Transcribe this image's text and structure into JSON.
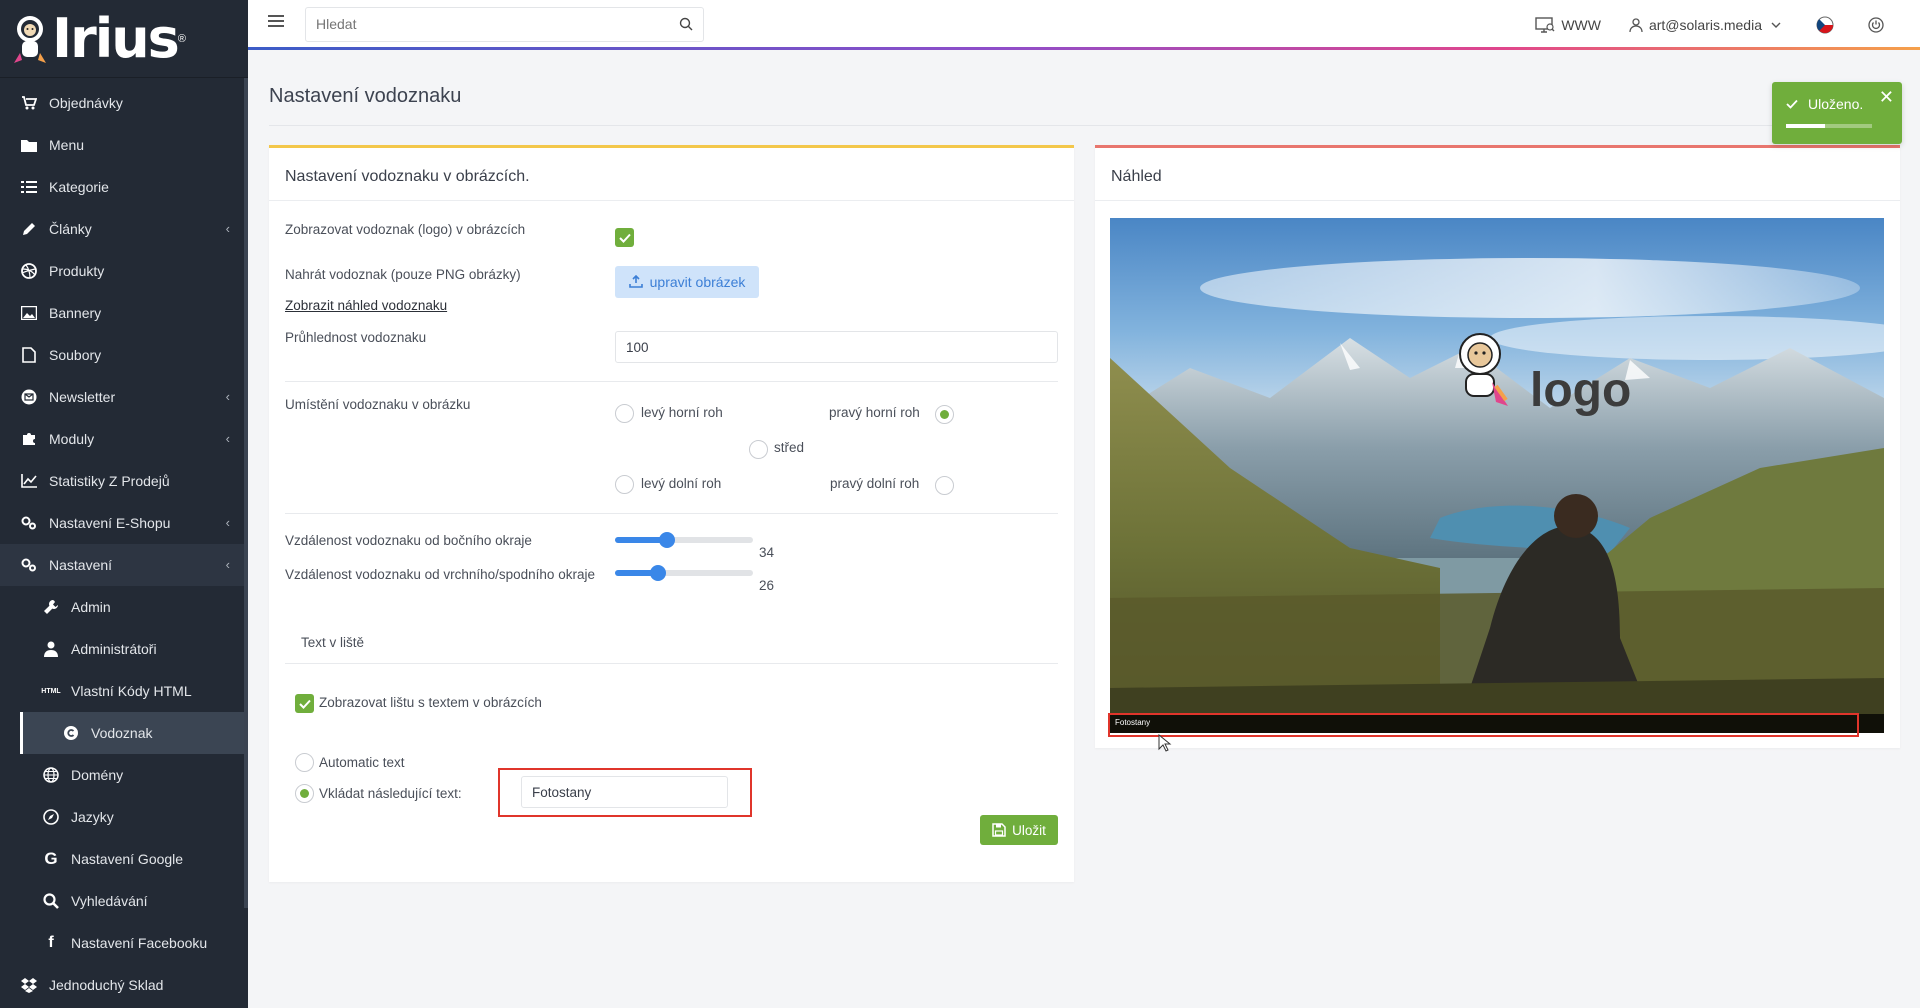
{
  "brand": {
    "name": "Irius",
    "reg": "®"
  },
  "sidebar": {
    "items": [
      {
        "label": "Objednávky",
        "icon": "cart-icon"
      },
      {
        "label": "Menu",
        "icon": "folder-icon"
      },
      {
        "label": "Kategorie",
        "icon": "list-icon"
      },
      {
        "label": "Články",
        "icon": "pencil-icon",
        "chevron": "‹"
      },
      {
        "label": "Produkty",
        "icon": "dribbble-icon"
      },
      {
        "label": "Bannery",
        "icon": "image-icon"
      },
      {
        "label": "Soubory",
        "icon": "file-icon"
      },
      {
        "label": "Newsletter",
        "icon": "envelope-circle-icon",
        "chevron": "‹"
      },
      {
        "label": "Moduly",
        "icon": "puzzle-icon",
        "chevron": "‹"
      },
      {
        "label": "Statistiky Z Prodejů",
        "icon": "chart-line-icon"
      },
      {
        "label": "Nastavení E-Shopu",
        "icon": "cogs-icon",
        "chevron": "‹"
      },
      {
        "label": "Nastavení",
        "icon": "cogs-icon",
        "chevron": "‹"
      }
    ],
    "sub_items": [
      {
        "label": "Admin",
        "icon": "wrench-icon"
      },
      {
        "label": "Administrátoři",
        "icon": "user-icon"
      },
      {
        "label": "Vlastní Kódy HTML",
        "icon": "html-icon"
      },
      {
        "label": "Vodoznak",
        "icon": "copyright-icon"
      },
      {
        "label": "Domény",
        "icon": "globe-icon"
      },
      {
        "label": "Jazyky",
        "icon": "compass-icon"
      },
      {
        "label": "Nastavení Google",
        "icon": "google-icon"
      },
      {
        "label": "Vyhledávání",
        "icon": "search-icon"
      },
      {
        "label": "Nastavení Facebooku",
        "icon": "facebook-icon"
      }
    ],
    "last_item": {
      "label": "Jednoduchý Sklad",
      "icon": "dropbox-icon"
    }
  },
  "topbar": {
    "search_placeholder": "Hledat",
    "www_label": "WWW",
    "user_email": "art@solaris.media"
  },
  "page": {
    "title": "Nastavení vodoznaku"
  },
  "form": {
    "card_title": "Nastavení vodoznaku v obrázcích.",
    "show_watermark_label": "Zobrazovat vodoznak (logo) v obrázcích",
    "upload_label": "Nahrát vodoznak (pouze PNG obrázky)",
    "upload_button": "upravit obrázek",
    "preview_link": "Zobrazit náhled vodoznaku",
    "opacity_label": "Průhlednost vodoznaku",
    "opacity_value": "100",
    "position_label": "Umístění vodoznaku v obrázku",
    "pos_top_left": "levý horní roh",
    "pos_top_right": "pravý horní roh",
    "pos_center": "střed",
    "pos_bottom_left": "levý dolní roh",
    "pos_bottom_right": "pravý dolní roh",
    "selected_position": "pravý horní roh",
    "side_distance_label": "Vzdálenost vodoznaku od bočního okraje",
    "side_distance_value": "34",
    "side_distance_fraction": 0.38,
    "top_distance_label": "Vzdálenost vodoznaku od vrchního/spodního okraje",
    "top_distance_value": "26",
    "top_distance_fraction": 0.31,
    "text_section_label": "Text v liště",
    "show_bar_label": "Zobrazovat lištu s textem v obrázcích",
    "auto_text_label": "Automatic text",
    "custom_text_label": "Vkládat následující text:",
    "custom_text_value": "Fotostany",
    "save_button": "Uložit"
  },
  "preview": {
    "title": "Náhled",
    "logo_text": "logo",
    "bar_text": "Fotostany"
  },
  "toast": {
    "message": "Uloženo."
  },
  "colors": {
    "accent_green": "#70ae3c",
    "sidebar_bg": "#232a35",
    "highlight_red": "#e0352b"
  }
}
